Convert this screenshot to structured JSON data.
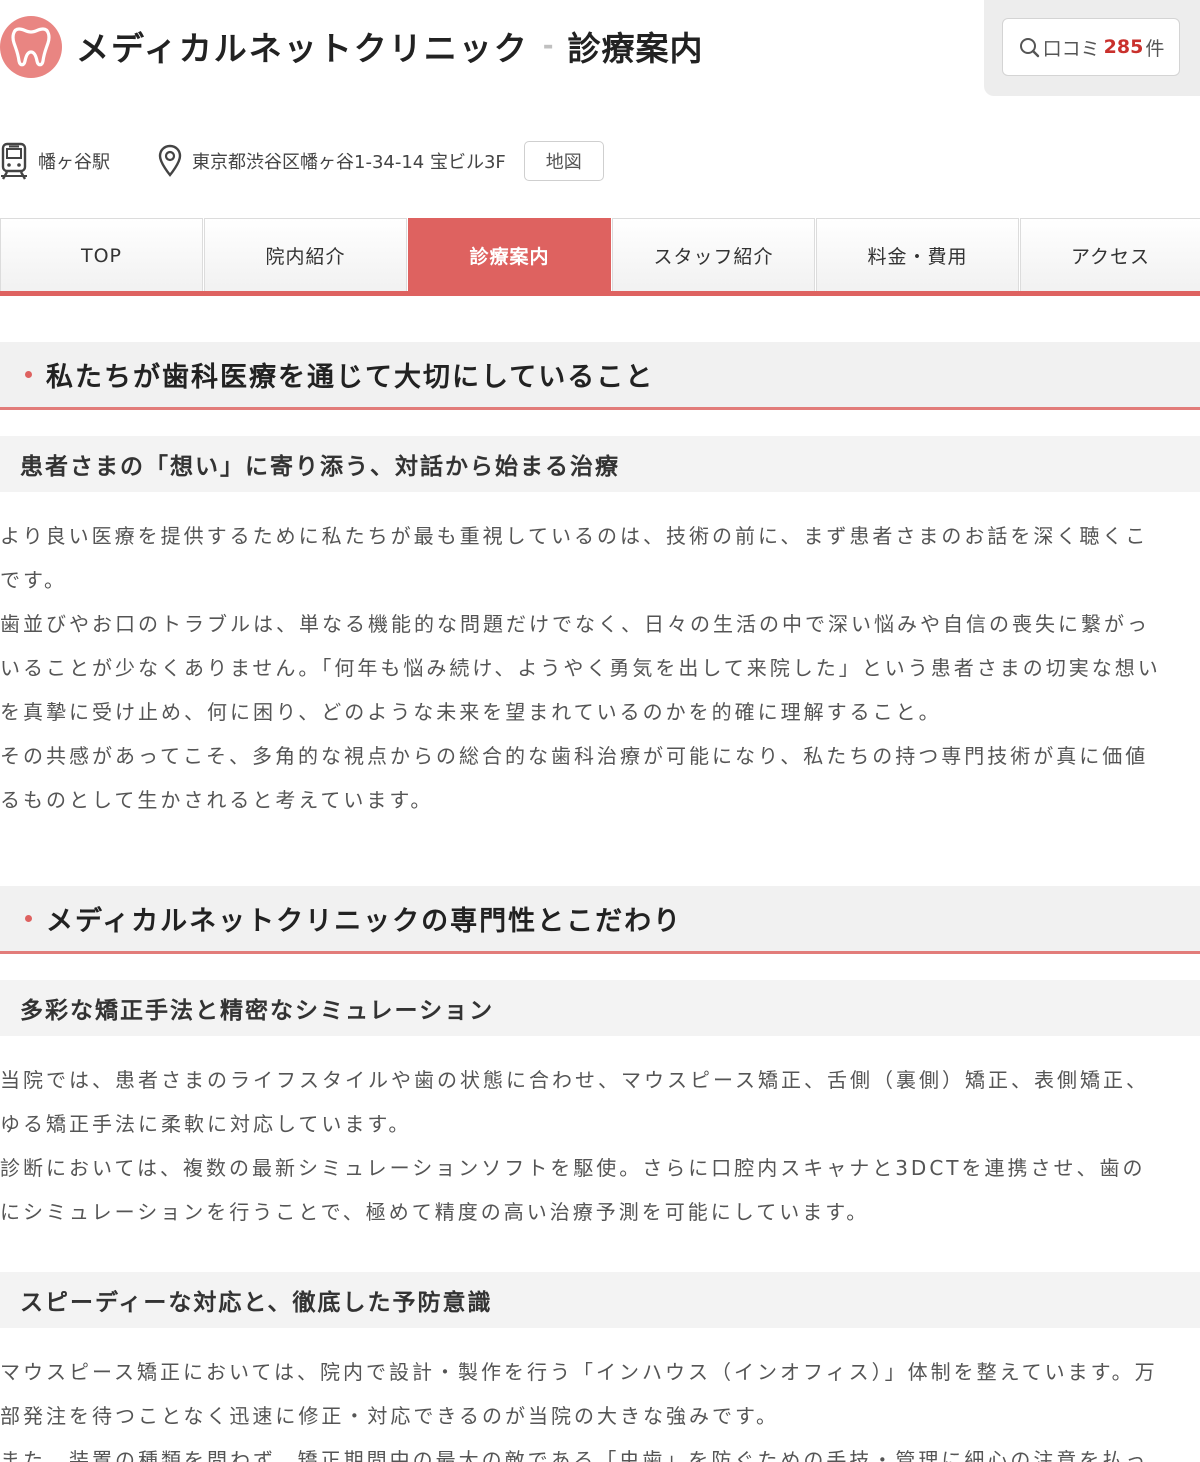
{
  "header": {
    "clinic_name": "メディカルネットクリニック",
    "separator": "-",
    "page_name": "診療案内",
    "review_label": "口コミ",
    "review_count": "285",
    "review_unit": "件"
  },
  "info": {
    "station": "幡ヶ谷駅",
    "address": "東京都渋谷区幡ヶ谷1-34-14 宝ビル3F",
    "map_label": "地図"
  },
  "tabs": [
    {
      "label": "TOP"
    },
    {
      "label": "院内紹介"
    },
    {
      "label": "診療案内"
    },
    {
      "label": "スタッフ紹介"
    },
    {
      "label": "料金・費用"
    },
    {
      "label": "アクセス"
    }
  ],
  "section1": {
    "heading": "私たちが歯科医療を通じて大切にしていること",
    "sub": "患者さまの「想い」に寄り添う、対話から始まる治療",
    "lines": [
      "より良い医療を提供するために私たちが最も重視しているのは、技術の前に、まず患者さまのお話を深く聴くこ",
      "です。",
      "歯並びやお口のトラブルは、単なる機能的な問題だけでなく、日々の生活の中で深い悩みや自信の喪失に繋がっ",
      "いることが少なくありません。「何年も悩み続け、ようやく勇気を出して来院した」という患者さまの切実な想い",
      "を真摯に受け止め、何に困り、どのような未来を望まれているのかを的確に理解すること。",
      "その共感があってこそ、多角的な視点からの総合的な歯科治療が可能になり、私たちの持つ専門技術が真に価値",
      "るものとして生かされると考えています。"
    ]
  },
  "section2": {
    "heading": "メディカルネットクリニックの専門性とこだわり",
    "sub1": "多彩な矯正手法と精密なシミュレーション",
    "lines1": [
      "当院では、患者さまのライフスタイルや歯の状態に合わせ、マウスピース矯正、舌側（裏側）矯正、表側矯正、",
      "ゆる矯正手法に柔軟に対応しています。",
      "診断においては、複数の最新シミュレーションソフトを駆使。さらに口腔内スキャナと3DCTを連携させ、歯の",
      "にシミュレーションを行うことで、極めて精度の高い治療予測を可能にしています。"
    ],
    "sub2": "スピーディーな対応と、徹底した予防意識",
    "lines2": [
      "マウスピース矯正においては、院内で設計・製作を行う「インハウス（インオフィス）」体制を整えています。万",
      "部発注を待つことなく迅速に修正・対応できるのが当院の大きな強みです。",
      "また、装置の種類を問わず、矯正期間中の最大の敵である「虫歯」を防ぐための手技・管理に細心の注意を払っ"
    ]
  },
  "colors": {
    "accent": "#de6260",
    "logo": "#e98582",
    "count": "#c9302c"
  }
}
